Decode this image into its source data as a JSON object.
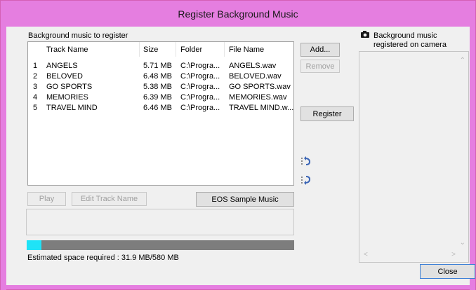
{
  "window": {
    "title": "Register Background Music"
  },
  "left": {
    "section_label": "Background music to register",
    "columns": [
      "Track Name",
      "Size",
      "Folder",
      "File Name"
    ],
    "rows": [
      {
        "num": "1",
        "track": "ANGELS",
        "size": "5.71 MB",
        "folder": "C:\\Progra...",
        "file": "ANGELS.wav"
      },
      {
        "num": "2",
        "track": "BELOVED",
        "size": "6.48 MB",
        "folder": "C:\\Progra...",
        "file": "BELOVED.wav"
      },
      {
        "num": "3",
        "track": "GO SPORTS",
        "size": "5.38 MB",
        "folder": "C:\\Progra...",
        "file": "GO SPORTS.wav"
      },
      {
        "num": "4",
        "track": "MEMORIES",
        "size": "6.39 MB",
        "folder": "C:\\Progra...",
        "file": "MEMORIES.wav"
      },
      {
        "num": "5",
        "track": "TRAVEL MIND",
        "size": "6.46 MB",
        "folder": "C:\\Progra...",
        "file": "TRAVEL MIND.w..."
      }
    ],
    "play_label": "Play",
    "edit_track_label": "Edit Track Name",
    "sample_music_label": "EOS Sample Music",
    "progress_fraction": 0.055,
    "space_text": "Estimated space required : 31.9 MB/580 MB"
  },
  "middle": {
    "add_label": "Add...",
    "remove_label": "Remove",
    "register_label": "Register",
    "icons": [
      "move-up-icon",
      "move-down-icon"
    ]
  },
  "right": {
    "header_line1": "Background music",
    "header_line2": "registered on camera",
    "header_icon": "camera-icon",
    "close_label": "Close"
  },
  "colors": {
    "titlebar": "#e57ee0",
    "progress_fill": "#1fe3f7",
    "progress_track": "#7d7d7d"
  }
}
